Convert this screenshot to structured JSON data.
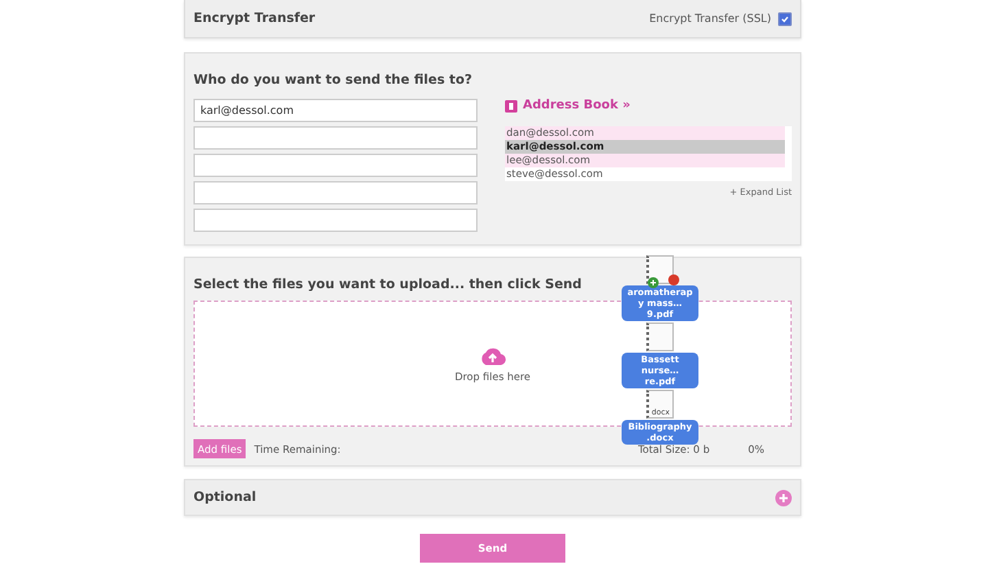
{
  "encrypt": {
    "title": "Encrypt Transfer",
    "option_label": "Encrypt Transfer (SSL)",
    "checked": true
  },
  "recipients": {
    "title": "Who do you want to send the files to?",
    "fields": [
      {
        "kind": "filled",
        "value": "karl@dessol.com"
      },
      {
        "kind": "blank"
      },
      {
        "kind": "blank"
      },
      {
        "kind": "blank"
      },
      {
        "kind": "blank"
      }
    ],
    "address_book": {
      "label": "Address Book »",
      "contacts": [
        {
          "email": "dan@dessol.com",
          "selected": false
        },
        {
          "email": "karl@dessol.com",
          "selected": true
        },
        {
          "email": "lee@dessol.com",
          "selected": false
        },
        {
          "email": "steve@dessol.com",
          "selected": false
        }
      ],
      "expand_link": "+ Expand List"
    }
  },
  "upload": {
    "title": "Select the files you want to upload... then click Send",
    "drop_hint": "Drop files here",
    "add_button": "Add files",
    "time_remaining": "Time Remaining:",
    "total_size": "Total Size: 0 b",
    "percent": "0%",
    "dragged_files": [
      {
        "name": "aromatherapy mass…9.pdf",
        "badges": true
      },
      {
        "name": "Bassett nurse…re.pdf",
        "badges": false
      },
      {
        "name": "Bibliography.docx",
        "badges": false,
        "type_label": "docx"
      }
    ]
  },
  "optional": {
    "title": "Optional",
    "expanded": false
  },
  "send_button": "Send"
}
